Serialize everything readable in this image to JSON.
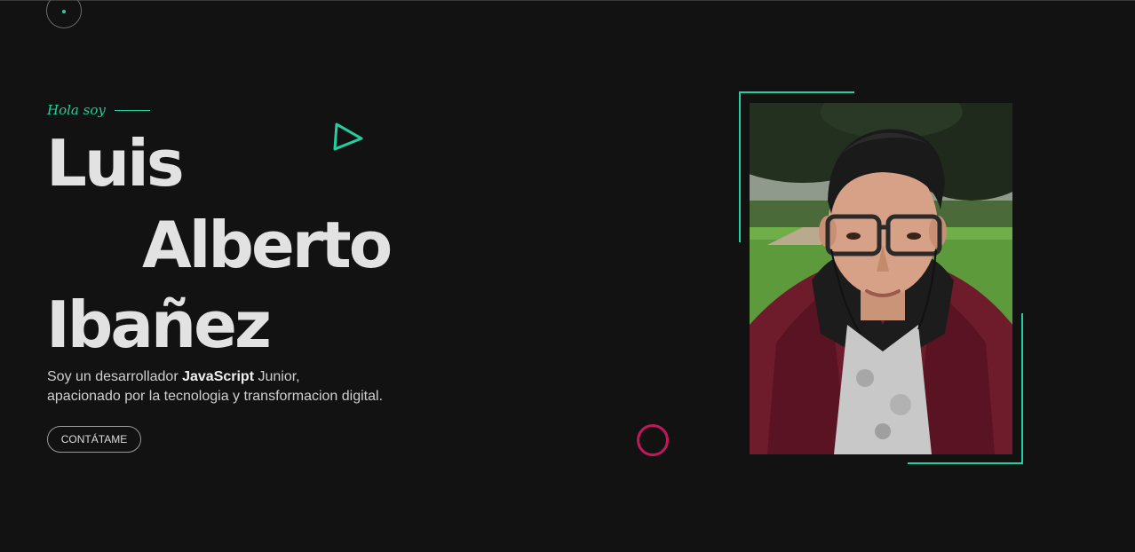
{
  "hero": {
    "greeting": "Hola soy",
    "name_first": "Luis",
    "name_middle": "Alberto",
    "name_last": "Ibañez",
    "intro_part1": "Soy un desarrollador ",
    "intro_highlight": "JavaScript",
    "intro_part2": " Junior,",
    "intro_line2": "apacionado por la tecnologia y transformacion digital.",
    "cta_label": "CONTÁTAME"
  },
  "colors": {
    "background": "#121212",
    "accent": "#1fd0a0",
    "ring": "#c2185b",
    "text": "#e2e2e2"
  },
  "icons": {
    "logo": "logo-circle-icon",
    "triangle": "triangle-play-icon",
    "ring": "ring-icon"
  },
  "photo": {
    "alt": "profile-photo"
  }
}
